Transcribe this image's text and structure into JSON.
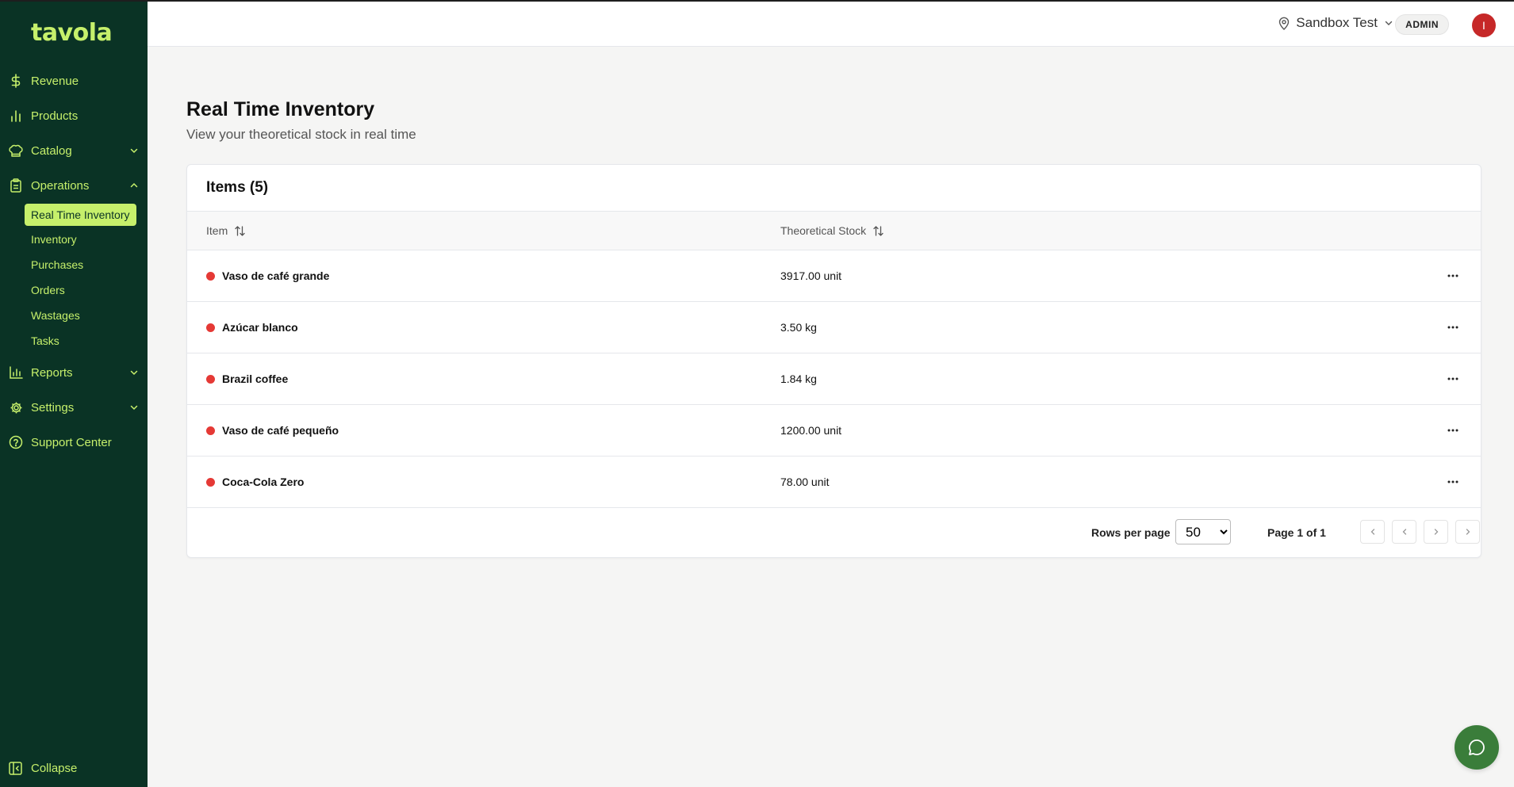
{
  "app": {
    "logo": "tavola"
  },
  "sidebar": {
    "items": [
      {
        "label": "Revenue"
      },
      {
        "label": "Products"
      },
      {
        "label": "Catalog"
      },
      {
        "label": "Operations"
      },
      {
        "label": "Reports"
      },
      {
        "label": "Settings"
      },
      {
        "label": "Support Center"
      }
    ],
    "operations_sub": [
      {
        "label": "Real Time Inventory",
        "active": true
      },
      {
        "label": "Inventory"
      },
      {
        "label": "Purchases"
      },
      {
        "label": "Orders"
      },
      {
        "label": "Wastages"
      },
      {
        "label": "Tasks"
      }
    ],
    "collapse_label": "Collapse"
  },
  "topbar": {
    "location": "Sandbox Test",
    "role": "ADMIN",
    "avatar_initial": "I"
  },
  "page": {
    "title": "Real Time Inventory",
    "subtitle": "View your theoretical stock in real time"
  },
  "table": {
    "title": "Items (5)",
    "columns": {
      "item": "Item",
      "stock": "Theoretical Stock"
    },
    "rows": [
      {
        "name": "Vaso de café grande",
        "stock": "3917.00 unit"
      },
      {
        "name": "Azúcar blanco",
        "stock": "3.50 kg"
      },
      {
        "name": "Brazil coffee",
        "stock": "1.84 kg"
      },
      {
        "name": "Vaso de café pequeño",
        "stock": "1200.00 unit"
      },
      {
        "name": "Coca-Cola Zero",
        "stock": "78.00 unit"
      }
    ],
    "status_color": "#e53935"
  },
  "pagination": {
    "rows_per_page_label": "Rows per page",
    "rows_per_page": "50",
    "page_info": "Page 1 of 1"
  },
  "colors": {
    "sidebar_bg": "#0a3325",
    "accent": "#c6f06b",
    "chat_button": "#3a7d3a"
  }
}
